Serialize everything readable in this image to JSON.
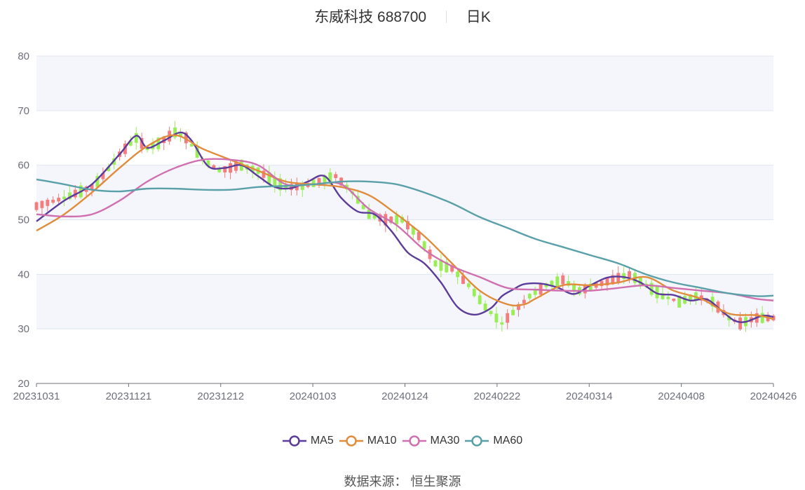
{
  "header": {
    "stock_name": "东威科技 688700",
    "period": "日K"
  },
  "source": {
    "label": "数据来源：",
    "value": "恒生聚源"
  },
  "chart_data": {
    "type": "candlestick",
    "title": "东威科技 688700",
    "period": "日K",
    "x_tick_labels": [
      "20231031",
      "20231121",
      "20231212",
      "20240103",
      "20240124",
      "20240222",
      "20240314",
      "20240408",
      "20240426"
    ],
    "y_ticks": [
      20,
      30,
      40,
      50,
      60,
      70,
      80
    ],
    "ylim": [
      20,
      80
    ],
    "grid": true,
    "colors": {
      "up": "#f47c7c",
      "down": "#99ee55",
      "band": "#f4f6fb"
    },
    "bars_count": 118,
    "ohlc_key_points": [
      [
        0,
        52.5
      ],
      [
        5,
        54
      ],
      [
        10,
        56
      ],
      [
        12,
        58
      ],
      [
        15,
        62
      ],
      [
        18,
        65
      ],
      [
        20,
        63
      ],
      [
        22,
        64
      ],
      [
        25,
        66
      ],
      [
        27,
        65
      ],
      [
        30,
        61
      ],
      [
        33,
        59
      ],
      [
        37,
        60
      ],
      [
        40,
        59
      ],
      [
        43,
        57
      ],
      [
        45,
        56
      ],
      [
        48,
        56
      ],
      [
        51,
        57
      ],
      [
        54,
        58
      ],
      [
        57,
        55
      ],
      [
        60,
        51
      ],
      [
        63,
        50
      ],
      [
        66,
        50
      ],
      [
        69,
        47
      ],
      [
        72,
        42
      ],
      [
        75,
        41
      ],
      [
        78,
        38
      ],
      [
        81,
        34
      ],
      [
        84,
        31
      ],
      [
        86,
        33
      ],
      [
        89,
        36
      ],
      [
        92,
        38
      ],
      [
        95,
        39
      ],
      [
        98,
        37
      ],
      [
        101,
        38
      ],
      [
        104,
        39
      ],
      [
        107,
        40
      ],
      [
        110,
        38
      ],
      [
        113,
        36
      ],
      [
        116,
        35
      ],
      [
        119,
        36
      ],
      [
        122,
        35
      ],
      [
        125,
        32
      ],
      [
        127,
        31
      ],
      [
        130,
        32
      ],
      [
        133,
        32
      ]
    ],
    "series": [
      {
        "name": "MA5",
        "color": "#5b3c9b",
        "x": [
          0,
          5,
          10,
          15,
          18,
          20,
          23,
          26,
          28,
          31,
          34,
          37,
          40,
          43,
          46,
          49,
          52,
          55,
          58,
          61,
          64,
          67,
          70,
          73,
          76,
          79,
          82,
          84,
          86,
          88,
          91,
          94,
          97,
          100,
          103,
          106,
          109,
          112,
          115,
          118,
          121,
          124,
          126,
          128,
          131,
          133
        ],
        "values": [
          49.7,
          53.5,
          56.5,
          62,
          65.4,
          63.2,
          64.5,
          66,
          64.5,
          59.8,
          59.5,
          60,
          58,
          56,
          55.8,
          57,
          58,
          54,
          51.5,
          51,
          48,
          44,
          42,
          38.5,
          34,
          32.6,
          33.8,
          36,
          37.2,
          38.2,
          38.3,
          37.6,
          36.4,
          38,
          39.4,
          39.5,
          38.5,
          36.5,
          36.2,
          35.2,
          35.4,
          33,
          31.5,
          31.3,
          32.4,
          32.2
        ]
      },
      {
        "name": "MA10",
        "color": "#e08c3c",
        "x": [
          0,
          5,
          10,
          15,
          20,
          25,
          30,
          35,
          40,
          45,
          50,
          55,
          60,
          65,
          70,
          75,
          80,
          85,
          88,
          90,
          95,
          100,
          105,
          110,
          115,
          120,
          125,
          130,
          133
        ],
        "values": [
          48,
          51,
          55,
          59.5,
          63.5,
          65.5,
          63,
          61,
          59,
          57,
          56.5,
          56,
          54.5,
          51,
          47,
          42,
          37,
          34.5,
          34.5,
          35.5,
          38,
          38,
          38.5,
          39.5,
          37,
          35.5,
          32.8,
          32.5,
          31.8
        ]
      },
      {
        "name": "MA30",
        "color": "#d070b0",
        "x": [
          0,
          5,
          10,
          15,
          20,
          25,
          30,
          35,
          40,
          45,
          50,
          55,
          60,
          65,
          70,
          75,
          80,
          85,
          90,
          95,
          100,
          105,
          110,
          115,
          120,
          125,
          130,
          133
        ],
        "values": [
          51,
          50.6,
          51,
          53.5,
          57,
          59.5,
          61,
          61,
          60,
          56.5,
          56.5,
          56.5,
          52,
          49,
          44.5,
          41.5,
          39.5,
          37.5,
          37.2,
          37,
          37,
          37.5,
          38,
          37.5,
          37,
          36.5,
          35.5,
          35.2
        ]
      },
      {
        "name": "MA60",
        "color": "#5aa0a8",
        "x": [
          0,
          5,
          10,
          15,
          20,
          25,
          30,
          35,
          40,
          45,
          50,
          55,
          60,
          65,
          70,
          75,
          80,
          85,
          90,
          95,
          100,
          105,
          110,
          115,
          120,
          125,
          130,
          133
        ],
        "values": [
          57.4,
          56.5,
          55.5,
          55.2,
          55.7,
          55.7,
          55.5,
          55.5,
          56,
          56.2,
          56.5,
          57,
          57,
          56.5,
          55,
          53,
          50.5,
          48.5,
          46.5,
          45,
          43.5,
          42,
          40,
          38.5,
          37.5,
          36.5,
          36,
          36.1
        ]
      }
    ]
  }
}
